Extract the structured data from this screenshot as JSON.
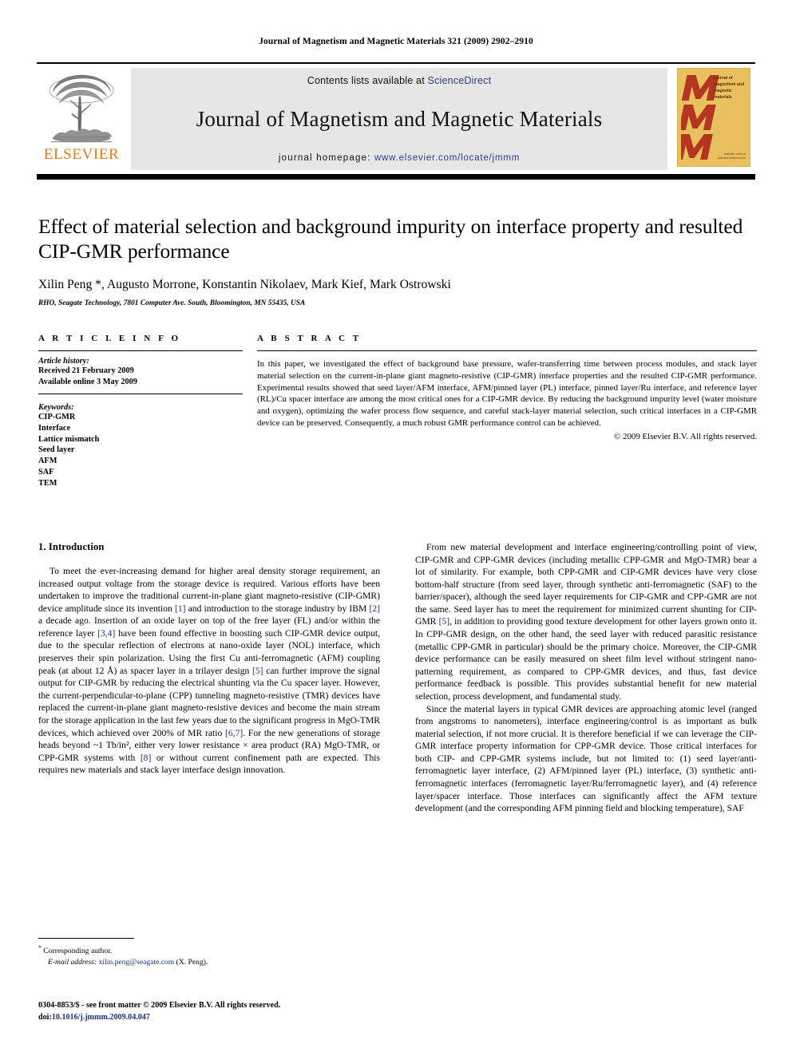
{
  "running_head": "Journal of Magnetism and Magnetic Materials 321 (2009) 2902–2910",
  "header": {
    "elsevier_wordmark": "ELSEVIER",
    "contents_prefix": "Contents lists available at ",
    "contents_link": "ScienceDirect",
    "journal_title": "Journal of Magnetism and Magnetic Materials",
    "homepage_prefix": "journal homepage: ",
    "homepage_link": "www.elsevier.com/locate/jmmm",
    "cover_title_lines": "journal of magnetism and magnetic materials",
    "cover_footer": "available online at www.sciencedirect.com"
  },
  "title_block": {
    "title": "Effect of material selection and background impurity on interface property and resulted CIP-GMR performance",
    "authors": "Xilin Peng *, Augusto Morrone, Konstantin Nikolaev, Mark Kief, Mark Ostrowski",
    "affiliation": "RHO, Seagate Technology, 7801 Computer Ave. South, Bloomington, MN 55435, USA"
  },
  "article_info": {
    "heading": "A R T I C L E  I N F O",
    "history_label": "Article history:",
    "history_lines": [
      "Received 21 February 2009",
      "Available online 3 May 2009"
    ],
    "keywords_label": "Keywords:",
    "keywords": [
      "CIP-GMR",
      "Interface",
      "Lattice mismatch",
      "Seed layer",
      "AFM",
      "SAF",
      "TEM"
    ]
  },
  "abstract": {
    "heading": "A B S T R A C T",
    "text": "In this paper, we investigated the effect of background base pressure, wafer-transferring time between process modules, and stack layer material selection on the current-in-plane giant magneto-resistive (CIP-GMR) interface properties and the resulted CIP-GMR performance. Experimental results showed that seed layer/AFM interface, AFM/pinned layer (PL) interface, pinned layer/Ru interface, and reference layer (RL)/Cu spacer interface are among the most critical ones for a CIP-GMR device. By reducing the background impurity level (water moisture and oxygen), optimizing the wafer process flow sequence, and careful stack-layer material selection, such critical interfaces in a CIP-GMR device can be preserved. Consequently, a much robust GMR performance control can be achieved.",
    "copyright": "© 2009 Elsevier B.V. All rights reserved."
  },
  "body": {
    "section_heading": "1. Introduction",
    "left_paragraphs": [
      "To meet the ever-increasing demand for higher areal density storage requirement, an increased output voltage from the storage device is required. Various efforts have been undertaken to improve the traditional current-in-plane giant magneto-resistive (CIP-GMR) device amplitude since its invention [1] and introduction to the storage industry by IBM [2] a decade ago. Insertion of an oxide layer on top of the free layer (FL) and/or within the reference layer [3,4] have been found effective in boosting such CIP-GMR device output, due to the specular reflection of electrons at nano-oxide layer (NOL) interface, which preserves their spin polarization. Using the first Cu anti-ferromagnetic (AFM) coupling peak (at about 12 Å) as spacer layer in a trilayer design [5] can further improve the signal output for CIP-GMR by reducing the electrical shunting via the Cu spacer layer. However, the current-perpendicular-to-plane (CPP) tunneling magneto-resistive (TMR) devices have replaced the current-in-plane giant magneto-resistive devices and become the main stream for the storage application in the last few years due to the significant progress in MgO-TMR devices, which achieved over 200% of MR ratio [6,7]. For the new generations of storage heads beyond ~1 Tb/in², either very lower resistance × area product (RA) MgO-TMR, or CPP-GMR systems with [8] or without current confinement path are expected. This requires new materials and stack layer interface design innovation."
    ],
    "right_paragraphs": [
      "From new material development and interface engineering/controlling point of view, CIP-GMR and CPP-GMR devices (including metallic CPP-GMR and MgO-TMR) bear a lot of similarity. For example, both CPP-GMR and CIP-GMR devices have very close bottom-half structure (from seed layer, through synthetic anti-ferromagnetic (SAF) to the barrier/spacer), although the seed layer requirements for CIP-GMR and CPP-GMR are not the same. Seed layer has to meet the requirement for minimized current shunting for CIP-GMR [5], in addition to providing good texture development for other layers grown onto it. In CPP-GMR design, on the other hand, the seed layer with reduced parasitic resistance (metallic CPP-GMR in particular) should be the primary choice. Moreover, the CIP-GMR device performance can be easily measured on sheet film level without stringent nano-patterning requirement, as compared to CPP-GMR devices, and thus, fast device performance feedback is possible. This provides substantial benefit for new material selection, process development, and fundamental study.",
      "Since the material layers in typical GMR devices are approaching atomic level (ranged from angstroms to nanometers), interface engineering/control is as important as bulk material selection, if not more crucial. It is therefore beneficial if we can leverage the CIP-GMR interface property information for CPP-GMR device. Those critical interfaces for both CIP- and CPP-GMR systems include, but not limited to: (1) seed layer/anti-ferromagnetic layer interface, (2) AFM/pinned layer (PL) interface, (3) synthetic anti-ferromagnetic interfaces (ferromagnetic layer/Ru/ferromagnetic layer), and (4) reference layer/spacer interface. Those interfaces can significantly affect the AFM texture development (and the corresponding AFM pinning field and blocking temperature), SAF"
    ]
  },
  "footnote": {
    "corresponding": "Corresponding author.",
    "email_label": "E-mail address:",
    "email": "xilin.peng@seagate.com",
    "email_suffix": "(X. Peng).",
    "issn_line": "0304-8853/$ - see front matter © 2009 Elsevier B.V. All rights reserved.",
    "doi_label": "doi:",
    "doi": "10.1016/j.jmmm.2009.04.047"
  },
  "colors": {
    "elsevier_orange": "#E87817",
    "link_blue": "#2a3d8f",
    "citation_blue": "#1c2f82",
    "banner_grey": "#e6e6e6",
    "cover_tan": "#e8c15e",
    "cover_red": "#b5361f"
  }
}
